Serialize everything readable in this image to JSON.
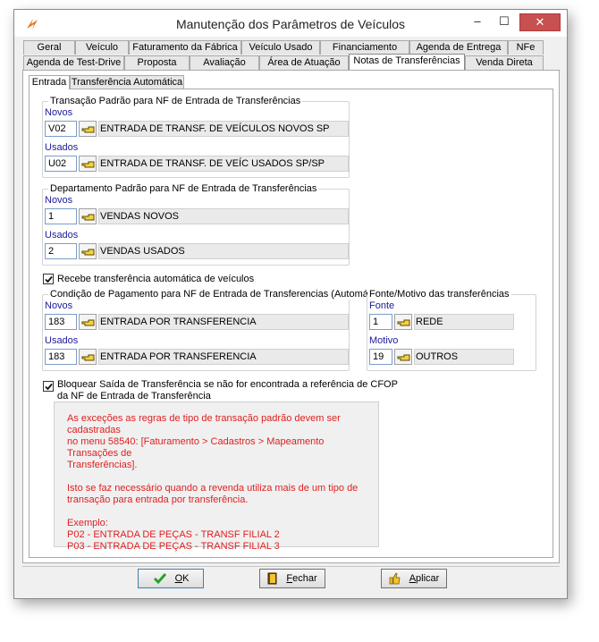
{
  "window": {
    "title": "Manutenção dos Parâmetros de Veículos",
    "controls": {
      "minimize": "–",
      "maximize": "☐",
      "close": "✕"
    }
  },
  "tabs": {
    "row1": [
      "Geral",
      "Veículo",
      "Faturamento da Fábrica",
      "Veículo Usado",
      "Financiamento",
      "Agenda de Entrega",
      "NFe"
    ],
    "row2": [
      "Agenda de Test-Drive",
      "Proposta",
      "Avaliação",
      "Área de Atuação",
      "Notas de Transferências",
      "Venda Direta"
    ],
    "active": "Notas de Transferências"
  },
  "subtabs": {
    "items": [
      "Entrada",
      "Transferência Automática"
    ],
    "active": "Entrada"
  },
  "transacao": {
    "title": "Transação Padrão para NF de Entrada de Transferências",
    "novos": {
      "label": "Novos",
      "code": "V02",
      "desc": "ENTRADA DE TRANSF. DE VEÍCULOS NOVOS SP"
    },
    "usados": {
      "label": "Usados",
      "code": "U02",
      "desc": "ENTRADA DE TRANSF. DE VEÍC USADOS  SP/SP"
    }
  },
  "departamento": {
    "title": "Departamento Padrão para NF de Entrada de Transferências",
    "novos": {
      "label": "Novos",
      "code": "1",
      "desc": "VENDAS NOVOS"
    },
    "usados": {
      "label": "Usados",
      "code": "2",
      "desc": "VENDAS USADOS"
    }
  },
  "recebe_transferencia": {
    "label": "Recebe transferência automática de veículos",
    "checked": true
  },
  "condicao": {
    "title": "Condição de Pagamento para NF de Entrada de Transferencias (Automática)",
    "novos": {
      "label": "Novos",
      "code": "183",
      "desc": "ENTRADA POR TRANSFERENCIA"
    },
    "usados": {
      "label": "Usados",
      "code": "183",
      "desc": "ENTRADA POR TRANSFERENCIA"
    }
  },
  "fonte_motivo": {
    "title": "Fonte/Motivo das transferências",
    "fonte": {
      "label": "Fonte",
      "code": "1",
      "desc": "REDE"
    },
    "motivo": {
      "label": "Motivo",
      "code": "19",
      "desc": "OUTROS"
    }
  },
  "bloquear": {
    "line1": "Bloquear Saída de Transferência se não for encontrada a referência de CFOP",
    "line2": "da NF de Entrada de Transferência",
    "checked": true
  },
  "notice": {
    "p1_l1": "As exceções as regras de tipo de transação padrão devem ser cadastradas",
    "p1_l2": "no menu 58540: [Faturamento > Cadastros > Mapeamento Transações de",
    "p1_l3": "Transferências].",
    "p2_l1": "Isto se faz necessário quando a revenda utiliza mais de um tipo de",
    "p2_l2": "transação para entrada por transferência.",
    "p3_l1": "Exemplo:",
    "p3_l2": "P02 - ENTRADA DE PEÇAS - TRANSF FILIAL 2",
    "p3_l3": "P03 - ENTRADA DE PEÇAS - TRANSF FILIAL 3",
    "color": "#e02020"
  },
  "buttons": {
    "ok": {
      "key": "O",
      "rest": "K"
    },
    "fechar": {
      "key": "F",
      "rest": "echar"
    },
    "aplicar": {
      "key": "A",
      "rest": "plicar"
    }
  }
}
